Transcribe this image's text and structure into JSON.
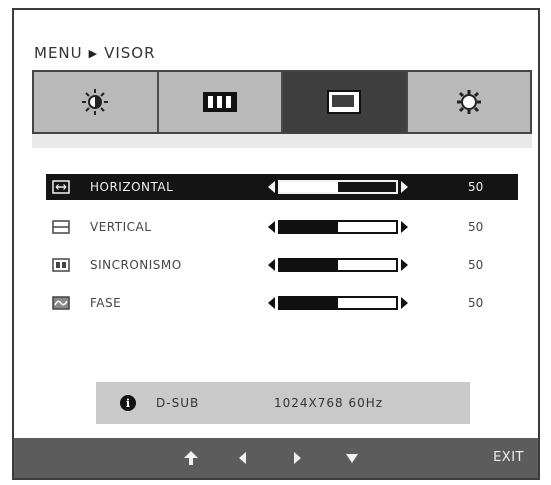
{
  "breadcrumb": {
    "menu": "MENU",
    "current": "VISOR"
  },
  "tabs": [
    {
      "icon": "brightness-icon",
      "active": false
    },
    {
      "icon": "color-bars-icon",
      "active": false
    },
    {
      "icon": "display-position-icon",
      "active": true
    },
    {
      "icon": "settings-gear-icon",
      "active": false
    }
  ],
  "rows": [
    {
      "label": "HORIZONTAL",
      "value": "50",
      "level": 0.5,
      "selected": true,
      "icon": "horizontal-position-icon"
    },
    {
      "label": "VERTICAL",
      "value": "50",
      "level": 0.5,
      "selected": false,
      "icon": "vertical-position-icon"
    },
    {
      "label": "SINCRONISMO",
      "value": "50",
      "level": 0.5,
      "selected": false,
      "icon": "clock-sync-icon"
    },
    {
      "label": "FASE",
      "value": "50",
      "level": 0.5,
      "selected": false,
      "icon": "phase-icon"
    }
  ],
  "info": {
    "source": "D-SUB",
    "mode": "1024X768  60Hz",
    "icon": "info-icon"
  },
  "nav": {
    "exit_label": "EXIT",
    "icons": [
      "up-return-icon",
      "left-arrow-icon",
      "right-arrow-icon",
      "down-arrow-icon"
    ]
  }
}
